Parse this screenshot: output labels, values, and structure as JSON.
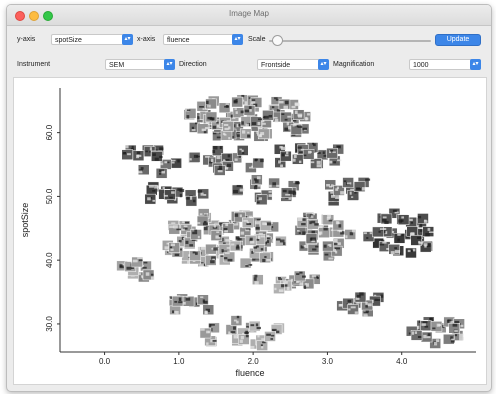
{
  "window": {
    "title": "Image Map"
  },
  "toolbar": {
    "y_axis_label": "y-axis",
    "y_axis_value": "spotSize",
    "x_axis_label": "x-axis",
    "x_axis_value": "fluence",
    "scale_label": "Scale",
    "scale_level": 0.05,
    "update_label": "Update"
  },
  "filters": {
    "instrument_label": "Instrument",
    "instrument_value": "SEM",
    "direction_label": "Direction",
    "direction_value": "Frontside",
    "magnification_label": "Magnification",
    "magnification_value": "1000"
  },
  "icons": {
    "select_arrow": "chevron-updown-icon"
  },
  "colors": {
    "accent": "#3c86e8",
    "window_bg": "#ececec"
  },
  "chart_data": {
    "type": "scatter",
    "mark": "image-thumbnail-clusters",
    "xlabel": "fluence",
    "ylabel": "spotSize",
    "xlim": [
      -0.6,
      5.0
    ],
    "ylim": [
      25.6,
      67.0
    ],
    "xticks": [
      0.0,
      1.0,
      2.0,
      3.0,
      4.0
    ],
    "yticks": [
      30.0,
      40.0,
      50.0,
      60.0
    ],
    "tick_labels_x": [
      "0.0",
      "1.0",
      "2.0",
      "3.0",
      "4.0"
    ],
    "tick_labels_y": [
      "30.0",
      "40.0",
      "50.0",
      "60.0"
    ],
    "grid": false,
    "clusters": [
      {
        "x": 1.95,
        "y": 62.2,
        "rx": 0.85,
        "ry": 3.4,
        "shade": "#8a8a8a",
        "count": 60
      },
      {
        "x": 0.6,
        "y": 55.6,
        "rx": 0.4,
        "ry": 2.2,
        "shade": "#5e5e5e",
        "count": 12
      },
      {
        "x": 1.65,
        "y": 55.9,
        "rx": 0.5,
        "ry": 2.0,
        "shade": "#6a6a6a",
        "count": 14
      },
      {
        "x": 2.7,
        "y": 56.3,
        "rx": 0.55,
        "ry": 2.0,
        "shade": "#5a5a5a",
        "count": 14
      },
      {
        "x": 0.95,
        "y": 50.5,
        "rx": 0.45,
        "ry": 1.6,
        "shade": "#555555",
        "count": 11
      },
      {
        "x": 2.15,
        "y": 51.0,
        "rx": 0.45,
        "ry": 1.8,
        "shade": "#6f6f6f",
        "count": 12
      },
      {
        "x": 3.25,
        "y": 51.0,
        "rx": 0.35,
        "ry": 2.0,
        "shade": "#606060",
        "count": 10
      },
      {
        "x": 1.6,
        "y": 43.3,
        "rx": 0.8,
        "ry": 4.3,
        "shade": "#9a9a9a",
        "count": 70
      },
      {
        "x": 2.95,
        "y": 43.9,
        "rx": 0.4,
        "ry": 3.3,
        "shade": "#8c8c8c",
        "count": 25
      },
      {
        "x": 4.0,
        "y": 44.0,
        "rx": 0.45,
        "ry": 3.6,
        "shade": "#4a4a4a",
        "count": 26
      },
      {
        "x": 0.45,
        "y": 38.5,
        "rx": 0.3,
        "ry": 1.3,
        "shade": "#9c9c9c",
        "count": 8
      },
      {
        "x": 2.45,
        "y": 36.8,
        "rx": 0.4,
        "ry": 1.4,
        "shade": "#a0a0a0",
        "count": 10
      },
      {
        "x": 1.15,
        "y": 32.8,
        "rx": 0.35,
        "ry": 1.4,
        "shade": "#959595",
        "count": 8
      },
      {
        "x": 3.45,
        "y": 33.2,
        "rx": 0.28,
        "ry": 1.9,
        "shade": "#6b6b6b",
        "count": 9
      },
      {
        "x": 1.85,
        "y": 28.6,
        "rx": 0.55,
        "ry": 2.3,
        "shade": "#a3a3a3",
        "count": 18
      },
      {
        "x": 4.5,
        "y": 28.8,
        "rx": 0.38,
        "ry": 2.2,
        "shade": "#7a7a7a",
        "count": 14
      }
    ]
  }
}
